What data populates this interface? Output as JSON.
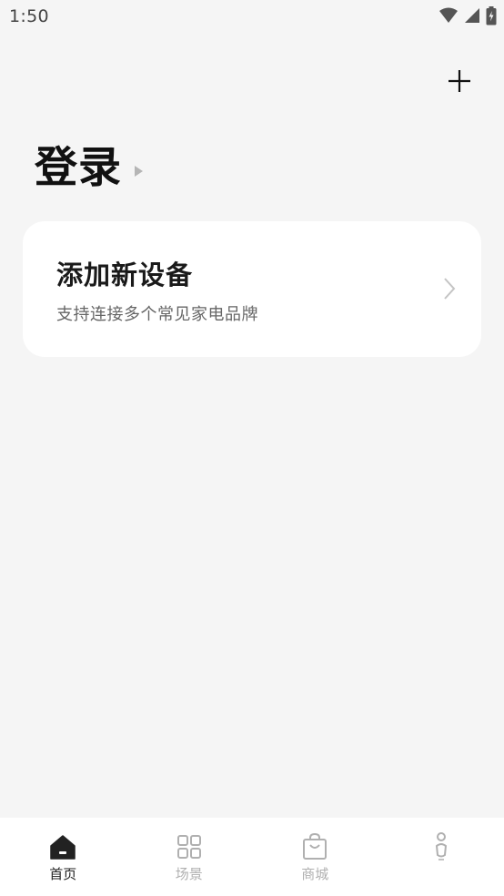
{
  "status_bar": {
    "time": "1:50"
  },
  "header": {
    "login_label": "登录",
    "add_icon": "plus-icon"
  },
  "device_card": {
    "title": "添加新设备",
    "subtitle": "支持连接多个常见家电品牌",
    "chevron_icon": "chevron-right-icon"
  },
  "bottom_nav": {
    "items": [
      {
        "label": "首页",
        "icon": "home-icon",
        "active": true
      },
      {
        "label": "场景",
        "icon": "grid-icon",
        "active": false
      },
      {
        "label": "商城",
        "icon": "shopping-bag-icon",
        "active": false
      },
      {
        "label": "",
        "icon": "profile-icon",
        "active": false
      }
    ]
  },
  "colors": {
    "background": "#f5f5f5",
    "card": "#ffffff",
    "active_nav": "#222222",
    "inactive_nav": "#b0b0b0"
  }
}
